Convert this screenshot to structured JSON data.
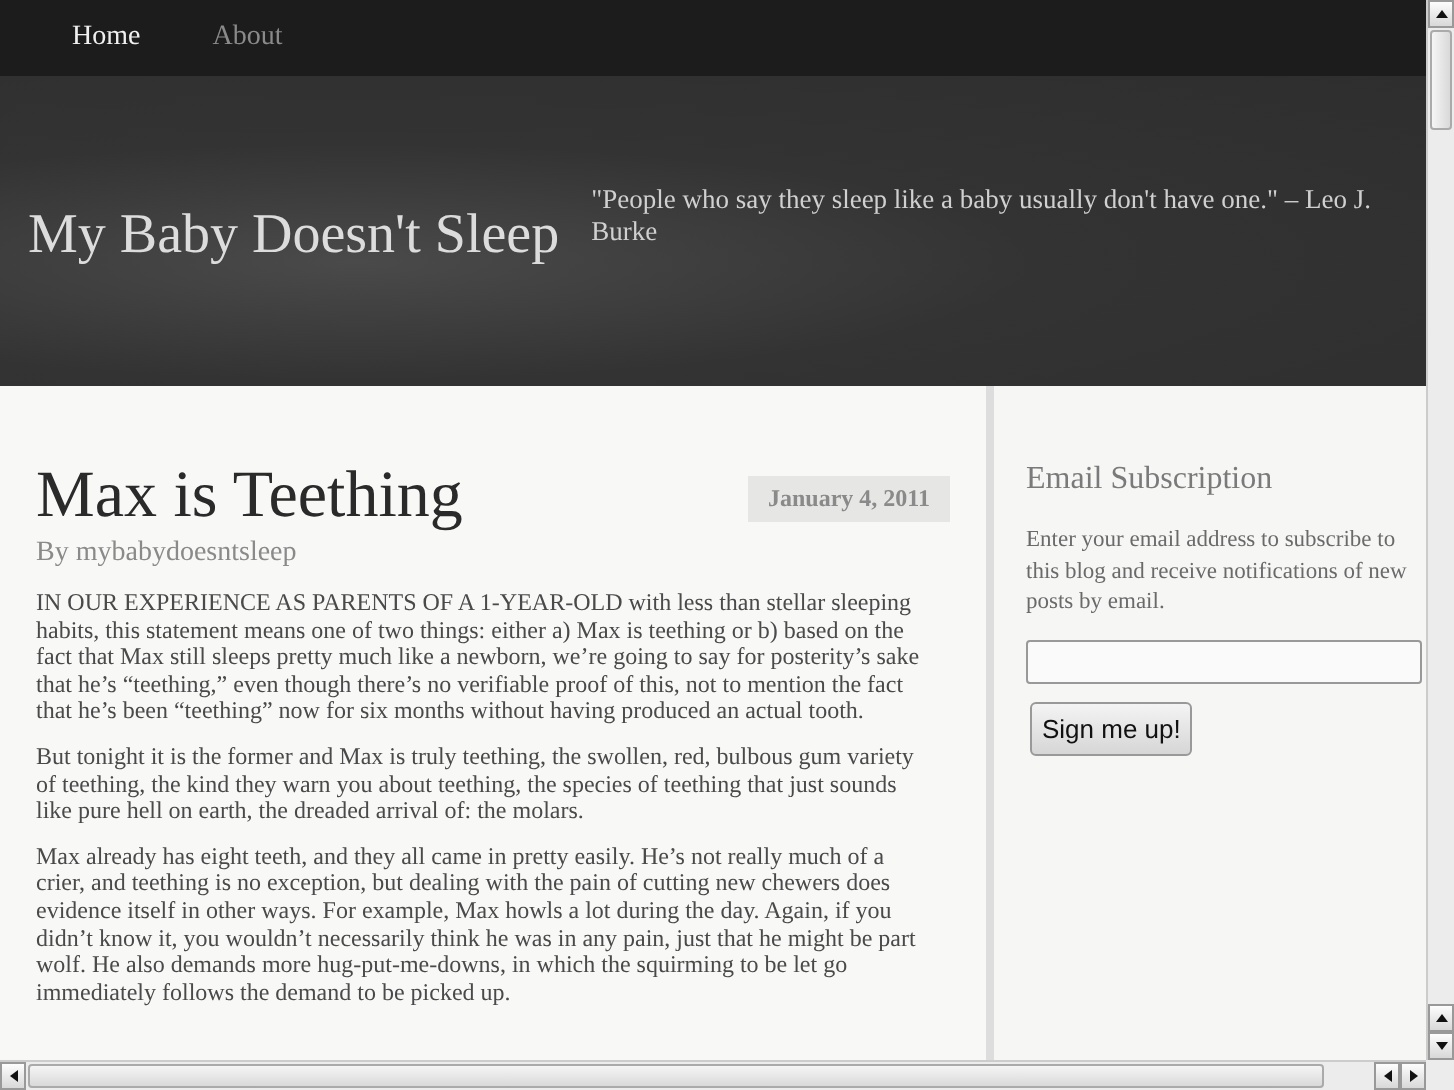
{
  "nav": [
    {
      "label": "Home",
      "selected": true
    },
    {
      "label": "About",
      "selected": false
    }
  ],
  "header": {
    "site_title": "My Baby Doesn't Sleep",
    "tagline": "\"People who say they sleep like a baby usually don't have one.\" – Leo J. Burke"
  },
  "post": {
    "title": "Max is Teething",
    "date": "January 4, 2011",
    "byline": "By mybabydoesntsleep",
    "paragraphs": [
      "IN OUR EXPERIENCE AS PARENTS OF A 1-YEAR-OLD with less than stellar sleeping habits, this statement means one of two things:  either a) Max is teething or b) based on the fact that Max still sleeps pretty much like a newborn, we’re going to say for posterity’s sake that he’s “teething,” even though there’s no verifiable proof of this, not to mention the fact that he’s been “teething” now for six months without having produced an actual tooth.",
      "But tonight it is the former and Max is truly teething, the swollen, red, bulbous gum variety of teething, the kind they warn you about teething, the species of teething that just sounds like pure hell on earth, the dreaded arrival of:  the molars.",
      "Max already has eight teeth, and they all came in pretty easily.  He’s not really much of a crier, and teething is no exception, but dealing with the pain of cutting new chewers does evidence itself in other ways.  For example, Max howls a lot during the day.  Again, if you didn’t know it, you wouldn’t necessarily think he was in any pain, just that he might be part wolf.  He also demands more hug-put-me-downs, in which the squirming to be let go immediately follows the demand to be picked up."
    ]
  },
  "sidebar": {
    "widget_title": "Email Subscription",
    "text": "Enter your email address to subscribe to this blog and receive notifications of new posts by email.",
    "button": "Sign me up!"
  }
}
